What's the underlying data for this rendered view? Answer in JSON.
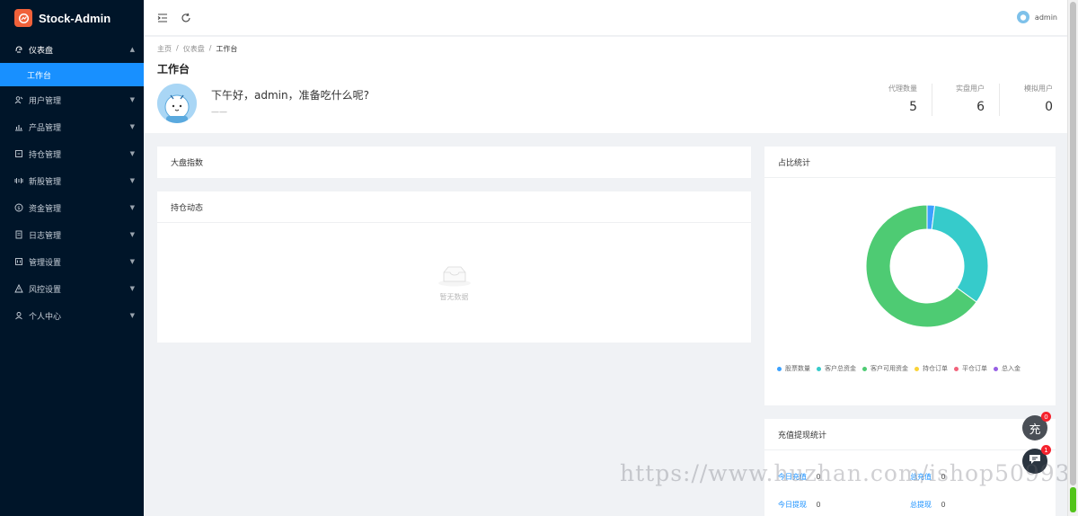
{
  "app": {
    "title": "Stock-Admin"
  },
  "sidebar": {
    "items": [
      {
        "label": "仪表盘",
        "icon": "dashboard-icon",
        "open": true
      },
      {
        "label": "用户管理",
        "icon": "users-icon"
      },
      {
        "label": "产品管理",
        "icon": "chart-bar-icon"
      },
      {
        "label": "持仓管理",
        "icon": "position-icon"
      },
      {
        "label": "新股管理",
        "icon": "new-stock-icon"
      },
      {
        "label": "资金管理",
        "icon": "money-icon"
      },
      {
        "label": "日志管理",
        "icon": "log-icon"
      },
      {
        "label": "管理设置",
        "icon": "settings-icon"
      },
      {
        "label": "风控设置",
        "icon": "warning-icon"
      },
      {
        "label": "个人中心",
        "icon": "user-icon"
      }
    ],
    "submenu": {
      "label": "工作台",
      "active": true
    }
  },
  "header": {
    "user_name": "admin"
  },
  "breadcrumb": [
    "主页",
    "/",
    "仪表盘",
    "/",
    "工作台"
  ],
  "page": {
    "title": "工作台",
    "greeting": "下午好，admin，准备吃什么呢?",
    "greeting_sub": "——"
  },
  "stats": [
    {
      "label": "代理数量",
      "value": "5"
    },
    {
      "label": "实盘用户",
      "value": "6"
    },
    {
      "label": "模拟用户",
      "value": "0"
    }
  ],
  "cards": {
    "market": {
      "title": "大盘指数"
    },
    "positions": {
      "title": "持仓动态",
      "empty_text": "暂无数据"
    },
    "ratio": {
      "title": "占比统计"
    },
    "recharge": {
      "title": "充值提现统计",
      "rows": [
        {
          "label": "今日充值",
          "value": "0"
        },
        {
          "label": "总充值",
          "value": "0"
        },
        {
          "label": "今日提现",
          "value": "0"
        },
        {
          "label": "总提现",
          "value": "0"
        }
      ]
    }
  },
  "chart_data": {
    "type": "pie",
    "variant": "donut",
    "categories": [
      "股票数量",
      "客户总资金",
      "客户可用资金",
      "持仓订单",
      "平仓订单",
      "总入金"
    ],
    "values": [
      2,
      33,
      65,
      0,
      0,
      0
    ],
    "colors": [
      "#3ba1ff",
      "#36cbcb",
      "#4ecb73",
      "#fad337",
      "#f2637b",
      "#975fe4"
    ],
    "legend_position": "bottom"
  },
  "floating": {
    "recharge_label": "充",
    "recharge_badge": "0",
    "chat_badge": "1"
  },
  "watermark": "https://www.huzhan.com/ishop50993"
}
